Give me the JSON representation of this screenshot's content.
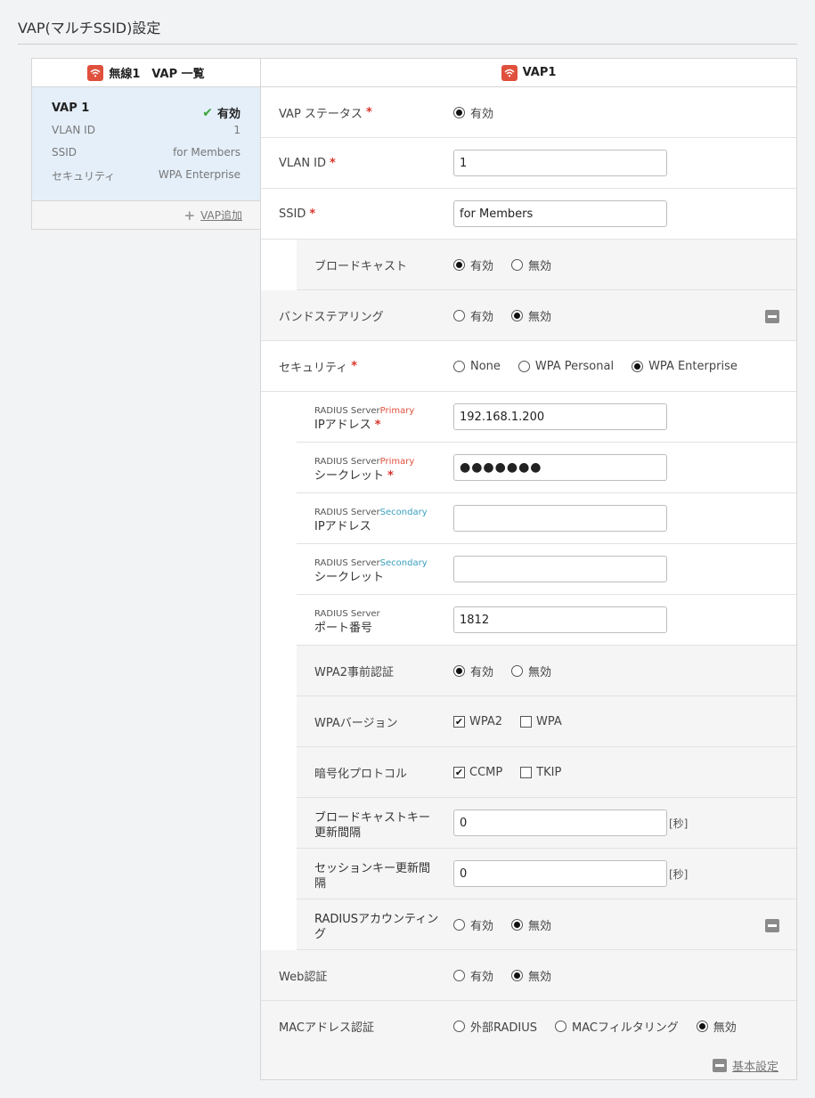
{
  "page_title": "VAP(マルチSSID)設定",
  "left": {
    "header": "無線1　VAP 一覧",
    "vap": {
      "name": "VAP 1",
      "status": "有効",
      "rows": [
        {
          "label": "VLAN ID",
          "value": "1"
        },
        {
          "label": "SSID",
          "value": "for Members"
        },
        {
          "label": "セキュリティ",
          "value": "WPA Enterprise"
        }
      ]
    },
    "add_label": "VAP追加"
  },
  "right": {
    "header": "VAP1",
    "vap_status": {
      "label": "VAP ステータス",
      "opt_enabled": "有効"
    },
    "vlan_id": {
      "label": "VLAN ID",
      "value": "1"
    },
    "ssid": {
      "label": "SSID",
      "value": "for Members"
    },
    "broadcast": {
      "label": "ブロードキャスト",
      "opt_on": "有効",
      "opt_off": "無効"
    },
    "band_steering": {
      "label": "バンドステアリング",
      "opt_on": "有効",
      "opt_off": "無効"
    },
    "security": {
      "label": "セキュリティ",
      "opt_none": "None",
      "opt_personal": "WPA Personal",
      "opt_enterprise": "WPA Enterprise"
    },
    "radius_primary_ip": {
      "prefix": "RADIUS Server",
      "tag": "Primary",
      "label": "IPアドレス",
      "value": "192.168.1.200"
    },
    "radius_primary_secret": {
      "prefix": "RADIUS Server",
      "tag": "Primary",
      "label": "シークレット",
      "value": "●●●●●●●"
    },
    "radius_secondary_ip": {
      "prefix": "RADIUS Server",
      "tag": "Secondary",
      "label": "IPアドレス",
      "value": ""
    },
    "radius_secondary_secret": {
      "prefix": "RADIUS Server",
      "tag": "Secondary",
      "label": "シークレット",
      "value": ""
    },
    "radius_port": {
      "prefix": "RADIUS Server",
      "label": "ポート番号",
      "value": "1812"
    },
    "wpa2_preauth": {
      "label": "WPA2事前認証",
      "opt_on": "有効",
      "opt_off": "無効"
    },
    "wpa_version": {
      "label": "WPAバージョン",
      "opt_wpa2": "WPA2",
      "opt_wpa": "WPA"
    },
    "cipher": {
      "label": "暗号化プロトコル",
      "opt_ccmp": "CCMP",
      "opt_tkip": "TKIP"
    },
    "bcast_key_interval": {
      "label_l1": "ブロードキャストキー",
      "label_l2": "更新間隔",
      "value": "0",
      "unit": "[秒]"
    },
    "session_key_interval": {
      "label_l1": "セッションキー更新間",
      "label_l2": "隔",
      "value": "0",
      "unit": "[秒]"
    },
    "radius_accounting": {
      "label_l1": "RADIUSアカウンティン",
      "label_l2": "グ",
      "opt_on": "有効",
      "opt_off": "無効"
    },
    "web_auth": {
      "label": "Web認証",
      "opt_on": "有効",
      "opt_off": "無効"
    },
    "mac_auth": {
      "label": "MACアドレス認証",
      "opt_radius": "外部RADIUS",
      "opt_filter": "MACフィルタリング",
      "opt_off": "無効"
    },
    "footer_link": "基本設定"
  }
}
